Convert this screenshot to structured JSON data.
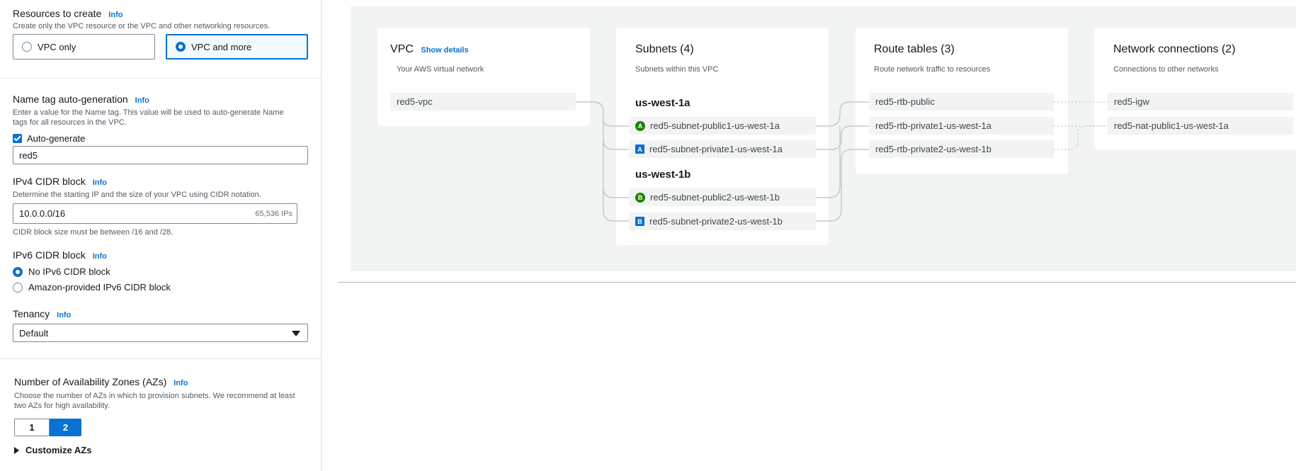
{
  "resources": {
    "label": "Resources to create",
    "info": "Info",
    "description": "Create only the VPC resource or the VPC and other networking resources.",
    "options": [
      "VPC only",
      "VPC and more"
    ],
    "selected": "VPC and more"
  },
  "name_tag": {
    "label": "Name tag auto-generation",
    "info": "Info",
    "description_1": "Enter a value for the Name tag. This value will be used to auto-generate Name",
    "description_2": "tags for all resources in the VPC.",
    "checkbox_label": "Auto-generate",
    "checked": true,
    "value": "red5"
  },
  "ipv4": {
    "label": "IPv4 CIDR block",
    "info": "Info",
    "description": "Determine the starting IP and the size of your VPC using CIDR notation.",
    "value": "10.0.0.0/16",
    "hint": "65,536 IPs",
    "constraint": "CIDR block size must be between /16 and /28."
  },
  "ipv6": {
    "label": "IPv6 CIDR block",
    "info": "Info",
    "options": [
      "No IPv6 CIDR block",
      "Amazon-provided IPv6 CIDR block"
    ],
    "selected": "No IPv6 CIDR block"
  },
  "tenancy": {
    "label": "Tenancy",
    "info": "Info",
    "value": "Default"
  },
  "azs": {
    "label": "Number of Availability Zones (AZs)",
    "info": "Info",
    "description_1": "Choose the number of AZs in which to provision subnets. We recommend at least",
    "description_2": "two AZs for high availability.",
    "options": [
      "1",
      "2"
    ],
    "selected": "2",
    "customize": "Customize AZs"
  },
  "diagram": {
    "vpc": {
      "title": "VPC",
      "show_details": "Show details",
      "subtitle": "Your AWS virtual network",
      "node": "red5-vpc"
    },
    "subnets": {
      "title": "Subnets (4)",
      "subtitle": "Subnets within this VPC",
      "zones": [
        {
          "name": "us-west-1a",
          "subnets": [
            {
              "badge": "A",
              "kind": "public",
              "name": "red5-subnet-public1-us-west-1a"
            },
            {
              "badge": "A",
              "kind": "private",
              "name": "red5-subnet-private1-us-west-1a"
            }
          ]
        },
        {
          "name": "us-west-1b",
          "subnets": [
            {
              "badge": "B",
              "kind": "public",
              "name": "red5-subnet-public2-us-west-1b"
            },
            {
              "badge": "B",
              "kind": "private",
              "name": "red5-subnet-private2-us-west-1b"
            }
          ]
        }
      ]
    },
    "route_tables": {
      "title": "Route tables (3)",
      "subtitle": "Route network traffic to resources",
      "items": [
        "red5-rtb-public",
        "red5-rtb-private1-us-west-1a",
        "red5-rtb-private2-us-west-1b"
      ]
    },
    "network_connections": {
      "title": "Network connections (2)",
      "subtitle": "Connections to other networks",
      "items": [
        "red5-igw",
        "red5-nat-public1-us-west-1a"
      ]
    },
    "colors": {
      "public_badge": "#1d8102",
      "private_badge": "#0972d3",
      "link": "#c6cacb"
    }
  }
}
